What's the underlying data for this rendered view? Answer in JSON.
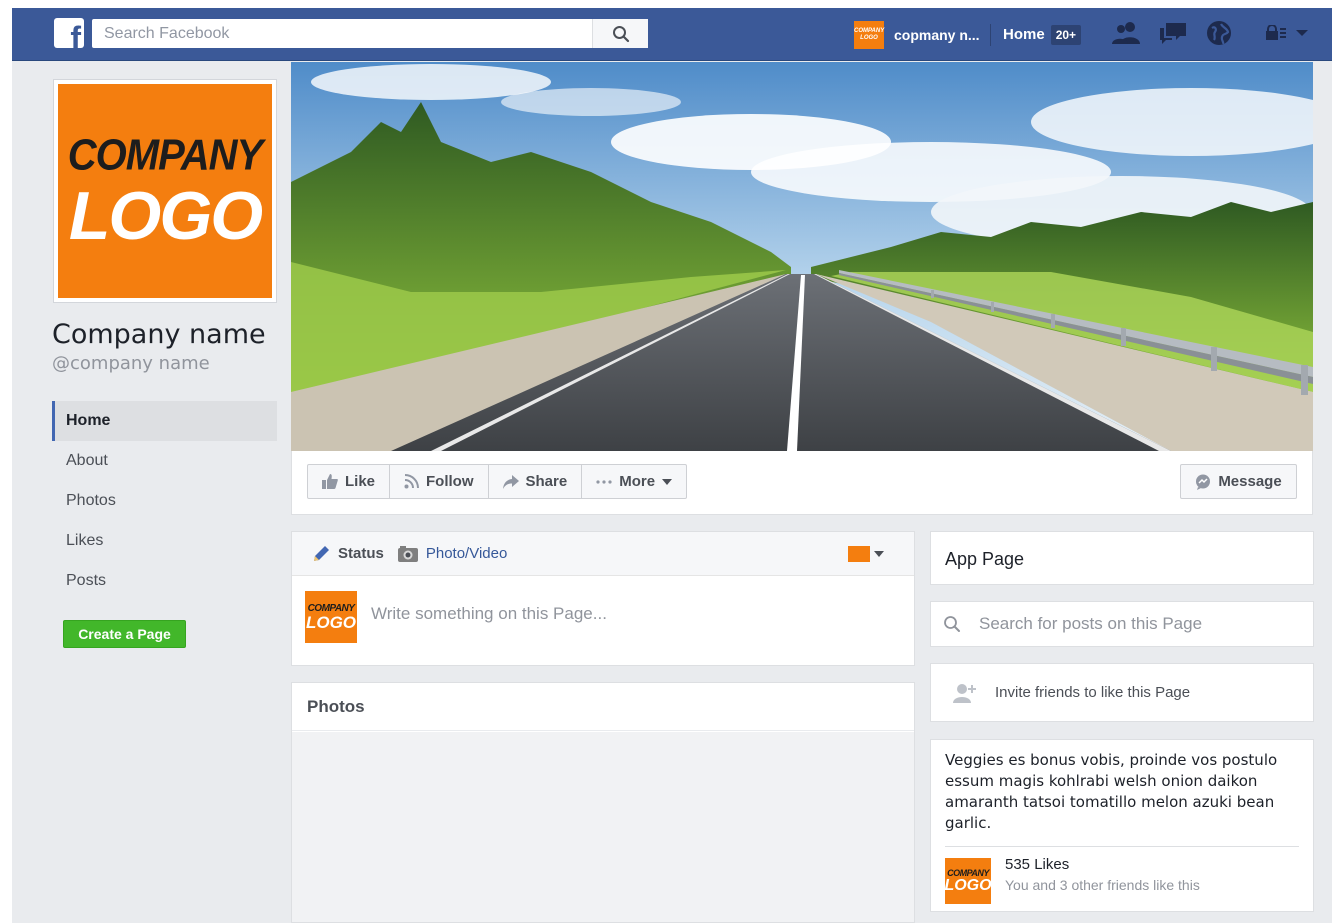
{
  "colors": {
    "brand_blue": "#3b5998",
    "accent_orange": "#f47e0f",
    "create_green": "#42b72a",
    "background": "#e9ebee"
  },
  "topbar": {
    "logo_letter": "f",
    "search_placeholder": "Search Facebook",
    "page_name_short": "copmany n...",
    "mini_logo_line1": "COMPANY",
    "mini_logo_line2": "LOGO",
    "home_label": "Home",
    "home_count": "20+",
    "icons": [
      "friend-requests-icon",
      "messages-icon",
      "notifications-globe-icon",
      "shortcuts-menu-icon",
      "chevron-down-icon"
    ]
  },
  "profile": {
    "logo_line1": "COMPANY",
    "logo_line2": "LOGO",
    "name": "Company name",
    "handle": "@company name"
  },
  "sidebar": {
    "items": [
      {
        "label": "Home",
        "active": true
      },
      {
        "label": "About"
      },
      {
        "label": "Photos"
      },
      {
        "label": "Likes"
      },
      {
        "label": "Posts"
      }
    ],
    "create_page": "Create a Page"
  },
  "actions": {
    "like": "Like",
    "follow": "Follow",
    "share": "Share",
    "more": "More",
    "message": "Message"
  },
  "composer": {
    "status_tab": "Status",
    "photo_tab": "Photo/Video",
    "placeholder": "Write something on this Page...",
    "avatar_line1": "COMPANY",
    "avatar_line2": "LOGO"
  },
  "photos": {
    "title": "Photos"
  },
  "right": {
    "app_page": "App Page",
    "search_placeholder": "Search for posts on this Page",
    "invite": "Invite friends to like this Page",
    "about_text": "Veggies es bonus vobis, proinde vos postulo essum magis kohlrabi welsh onion daikon amaranth tatsoi tomatillo melon azuki bean garlic.",
    "likes_count": "535 Likes",
    "likes_friends": "You and 3 other friends like this",
    "avatar_line1": "COMPANY",
    "avatar_line2": "LOGO"
  }
}
